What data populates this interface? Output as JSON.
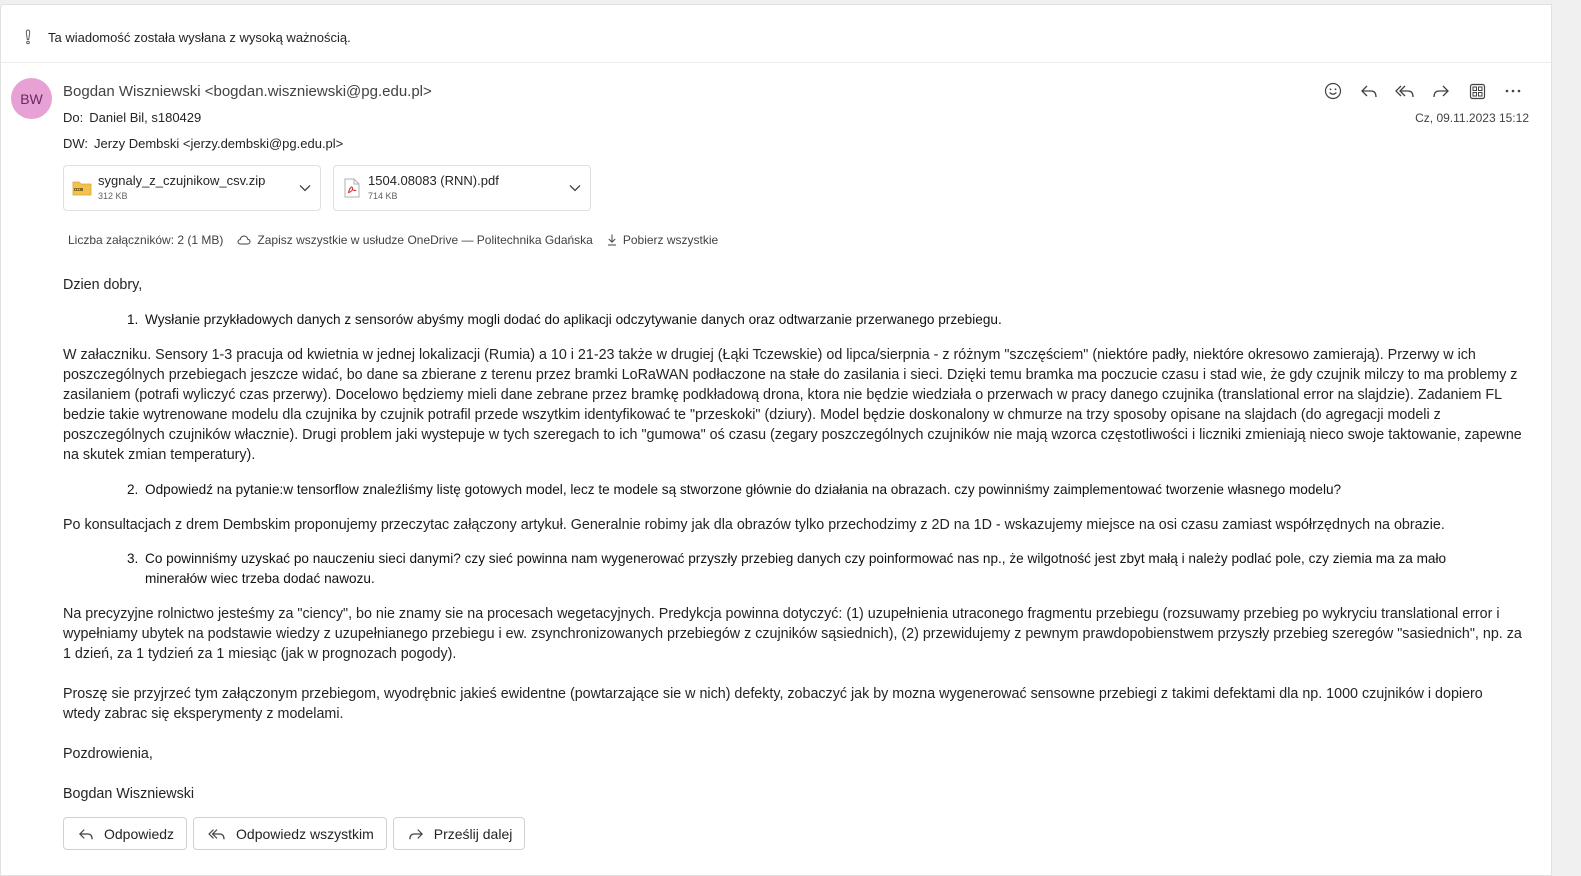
{
  "importance": {
    "icon": "exclamation-icon",
    "text": "Ta wiadomość została wysłana z wysoką ważnością."
  },
  "sender": {
    "initials": "BW",
    "avatar_color": "#e7a1d5",
    "display": "Bogdan Wiszniewski <bogdan.wiszniewski@pg.edu.pl>"
  },
  "recipients": {
    "to_label": "Do:",
    "to": "Daniel Bil, s180429",
    "cc_label": "DW:",
    "cc": "Jerzy Dembski <jerzy.dembski@pg.edu.pl>"
  },
  "datetime": "Cz, 09.11.2023 15:12",
  "actions": [
    "emoji-icon",
    "reply-icon",
    "reply-all-icon",
    "forward-icon",
    "apps-icon",
    "more-icon"
  ],
  "attachments": [
    {
      "name": "sygnaly_z_czujnikow_csv.zip",
      "size": "312 KB",
      "icon": "zip-file-icon"
    },
    {
      "name": "1504.08083 (RNN).pdf",
      "size": "714 KB",
      "icon": "pdf-file-icon"
    }
  ],
  "attachment_bar": {
    "count": "Liczba załączników: 2 (1 MB)",
    "save_onedrive": "Zapisz wszystkie w usłudze OneDrive — Politechnika Gdańska",
    "download_all": "Pobierz wszystkie"
  },
  "message": {
    "greeting": "Dzien dobry,",
    "item1_num": "1.",
    "item1": "Wysłanie przykładowych danych z sensorów abyśmy mogli dodać do aplikacji odczytywanie danych oraz odtwarzanie przerwanego przebiegu.",
    "para1": "W załaczniku. Sensory 1-3 pracuja od kwietnia w jednej lokalizacji (Rumia) a 10 i 21-23 także w drugiej (Łąki Tczewskie) od lipca/sierpnia - z różnym \"szczęściem\" (niektóre padły, niektóre okresowo zamierają). Przerwy w ich poszczególnych przebiegach jeszcze widać, bo dane sa zbierane z terenu przez bramki LoRaWAN podłaczone na stałe do zasilania i sieci. Dzięki temu bramka ma poczucie czasu i stad wie, że gdy czujnik milczy to ma problemy z zasilaniem (potrafi wyliczyć czas przerwy). Docelowo będziemy mieli dane zebrane przez bramkę podkładową drona, ktora nie będzie wiedziała o przerwach w pracy danego czujnika (translational error na slajdzie). Zadaniem FL bedzie takie wytrenowane modelu dla czujnika by czujnik potrafil przede wszytkim identyfikować te \"przeskoki\" (dziury). Model będzie doskonalony w chmurze na trzy sposoby opisane na slajdach (do agregacji modeli z poszczególnych czujników włacznie). Drugi problem jaki wystepuje w tych szeregach to ich \"gumowa\" oś czasu (zegary poszczególnych czujników nie mają wzorca częstotliwości i liczniki zmieniają nieco swoje taktowanie, zapewne na skutek zmian temperatury).",
    "item2_num": "2.",
    "item2": "Odpowiedź na pytanie:w tensorflow znaleźliśmy listę gotowych model, lecz te modele są stworzone głównie do działania na obrazach. czy powinniśmy zaimplementować tworzenie własnego modelu?",
    "para2": "Po konsultacjach z drem Dembskim proponujemy przeczytac załączony artykuł. Generalnie robimy jak dla obrazów tylko przechodzimy z 2D na 1D - wskazujemy miejsce na osi czasu zamiast współrzędnych na obrazie.",
    "item3_num": "3.",
    "item3": "Co powinniśmy uzyskać po nauczeniu sieci danymi? czy sieć powinna nam wygenerować przyszły przebieg danych czy poinformować nas np., że wilgotność jest zbyt małą i należy podlać pole, czy ziemia ma za mało minerałów wiec trzeba dodać nawozu.",
    "para3": "Na precyzyjne rolnictwo jesteśmy za \"ciency\", bo nie znamy sie na procesach wegetacyjnych. Predykcja powinna dotyczyć: (1) uzupełnienia utraconego fragmentu przebiegu (rozsuwamy przebieg po wykryciu translational error i wypełniamy ubytek na podstawie wiedzy z uzupełnianego przebiegu i ew. zsynchronizowanych przebiegów z czujników sąsiednich), (2) przewidujemy z pewnym prawdopobienstwem przyszły przebieg szeregów \"sasiednich\", np. za 1 dzień, za 1 tydzień za 1 miesiąc (jak w prognozach pogody).",
    "para4": "Proszę sie przyjrzeć tym załączonym przebiegom, wyodrębnic jakieś ewidentne (powtarzające sie w nich) defekty, zobaczyć jak by mozna wygenerować sensowne przebiegi z takimi defektami dla np. 1000 czujników i dopiero wtedy zabrac się eksperymenty z modelami.",
    "closing": "Pozdrowienia,",
    "signature": "Bogdan Wiszniewski"
  },
  "reply_buttons": {
    "reply": "Odpowiedz",
    "reply_all": "Odpowiedz wszystkim",
    "forward": "Prześlij dalej"
  }
}
